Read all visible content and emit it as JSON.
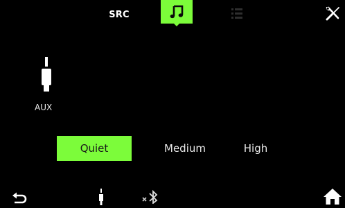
{
  "header": {
    "src_label": "SRC",
    "tabs": [
      {
        "icon": "music-note-icon",
        "active": true
      },
      {
        "icon": "list-icon",
        "active": false
      }
    ],
    "tools_icon": "tools-icon"
  },
  "source": {
    "icon": "aux-plug-icon",
    "label": "AUX"
  },
  "levels": {
    "options": [
      "Quiet",
      "Medium",
      "High"
    ],
    "selected": "Quiet"
  },
  "footer": {
    "icons": [
      "back-arrow-icon",
      "aux-plug-icon",
      "bluetooth-disconnected-icon",
      "home-icon"
    ]
  },
  "colors": {
    "accent": "#7cfc3a",
    "background": "#000000",
    "text": "#e8e8e8"
  }
}
